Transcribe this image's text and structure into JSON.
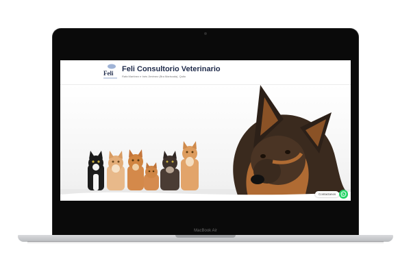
{
  "device": {
    "model_label": "MacBook Air"
  },
  "site": {
    "logo_text": "Feli",
    "title": "Feli Consultorio Veterinario",
    "subtitle": "Rafa Martínez e Inés Jiménez (Bra Mariscala), Quito"
  },
  "hero": {
    "animals": [
      "kitten-black-white",
      "kitten-orange-tabby",
      "kitten-orange-tabby",
      "kitten-orange-tabby",
      "kitten-dark-tabby",
      "kitten-orange-tabby",
      "german-shepherd-dog"
    ]
  },
  "contact": {
    "label": "Contactanos",
    "whatsapp_icon": "whatsapp-icon",
    "whatsapp_color": "#25d366"
  },
  "colors": {
    "title": "#1e2a4a",
    "bezel": "#0a0a0a"
  }
}
